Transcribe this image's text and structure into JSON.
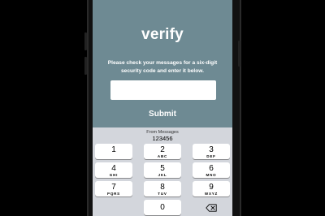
{
  "app": {
    "title": "verify",
    "instructions": "Please check your messages for a six-digit security code and enter it below.",
    "code_input": {
      "value": "",
      "placeholder": ""
    },
    "submit_label": "Submit",
    "background_color": "#6e8a93"
  },
  "keyboard": {
    "suggestion": {
      "label": "From Messages",
      "code": "123456"
    },
    "keys": [
      {
        "num": "1",
        "letters": ""
      },
      {
        "num": "2",
        "letters": "ABC"
      },
      {
        "num": "3",
        "letters": "DEF"
      },
      {
        "num": "4",
        "letters": "GHI"
      },
      {
        "num": "5",
        "letters": "JKL"
      },
      {
        "num": "6",
        "letters": "MNO"
      },
      {
        "num": "7",
        "letters": "PQRS"
      },
      {
        "num": "8",
        "letters": "TUV"
      },
      {
        "num": "9",
        "letters": "WXYZ"
      },
      {
        "num": "0",
        "letters": ""
      }
    ],
    "delete_icon": "backspace-icon"
  }
}
